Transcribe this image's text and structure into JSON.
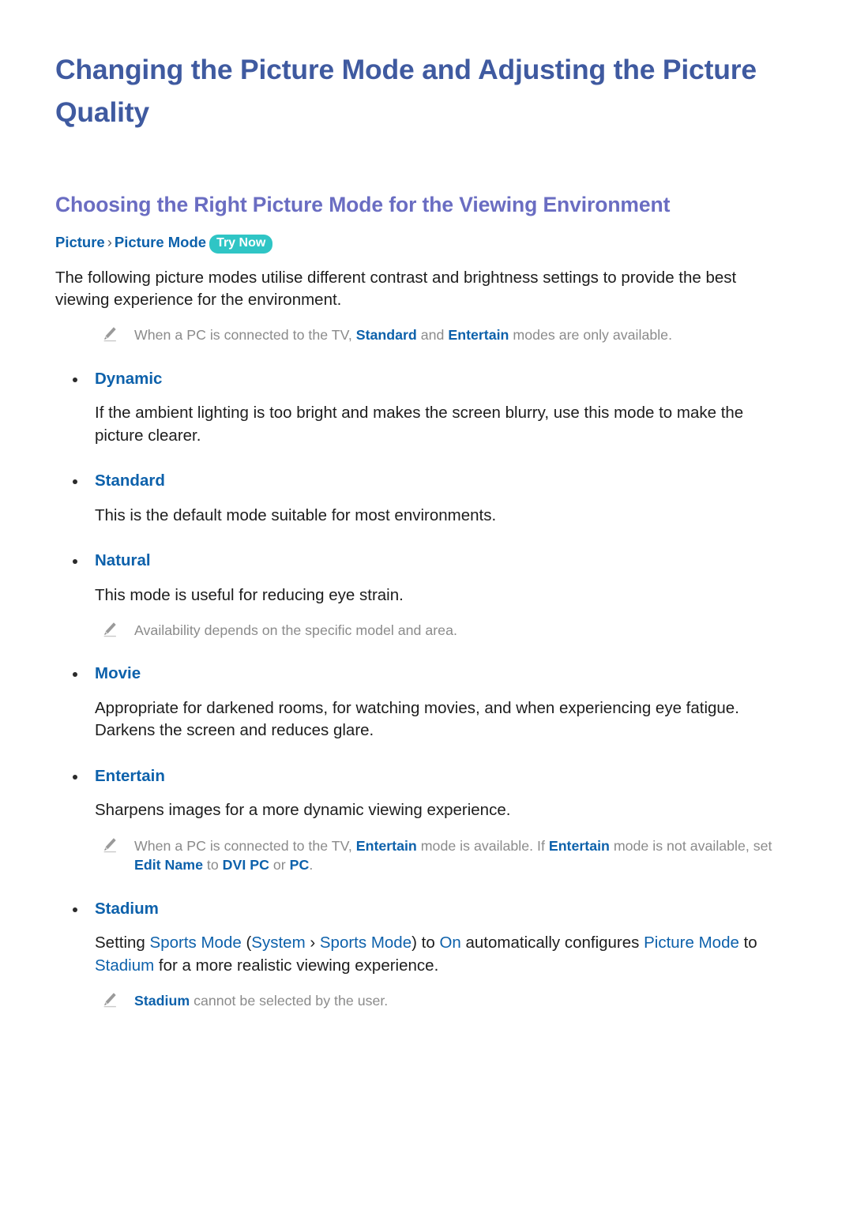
{
  "document": {
    "title": "Changing the Picture Mode and Adjusting the Picture Quality",
    "section_title": "Choosing the Right Picture Mode for the Viewing Environment"
  },
  "breadcrumb": {
    "root": "Picture",
    "separator": "›",
    "leaf": "Picture Mode",
    "badge": "Try Now"
  },
  "intro": {
    "paragraph": "The following picture modes utilise different contrast and brightness settings to provide the best viewing experience for the environment."
  },
  "intro_note": {
    "icon": "pencil-icon",
    "text_1": "When a PC is connected to the TV, ",
    "term_1": "Standard",
    "text_2": " and ",
    "term_2": "Entertain",
    "text_3": " modes are only available."
  },
  "modes": [
    {
      "label": "Dynamic",
      "description": "If the ambient lighting is too bright and makes the screen blurry, use this mode to make the picture clearer."
    },
    {
      "label": "Standard",
      "description": "This is the default mode suitable for most environments."
    },
    {
      "label": "Natural",
      "description": "This mode is useful for reducing eye strain.",
      "note": "Availability depends on the specific model and area."
    },
    {
      "label": "Movie",
      "description": "Appropriate for darkened rooms, for watching movies, and when experiencing eye fatigue. Darkens the screen and reduces glare."
    },
    {
      "label": "Entertain",
      "description": "Sharpens images for a more dynamic viewing experience."
    },
    {
      "label": "Stadium"
    }
  ],
  "entertain_note": {
    "icon": "pencil-icon",
    "t1": "When a PC is connected to the TV, ",
    "k1": "Entertain",
    "t2": " mode is available. If ",
    "k2": "Entertain",
    "t3": " mode is not available, set ",
    "k3": "Edit Name",
    "t4": " to ",
    "k4": "DVI PC",
    "t5": " or ",
    "k5": "PC",
    "t6": "."
  },
  "stadium_body": {
    "t1": "Setting ",
    "k1": "Sports Mode",
    "t2": " (",
    "k2": "System",
    "t3": " › ",
    "k3": "Sports Mode",
    "t4": ") to ",
    "k4": "On",
    "t5": " automatically configures ",
    "k5": "Picture Mode",
    "t6": " to ",
    "k6": "Stadium",
    "t7": " for a more realistic viewing experience."
  },
  "stadium_note": {
    "icon": "pencil-icon",
    "k1": "Stadium",
    "t1": " cannot be selected by the user."
  },
  "colors": {
    "doc_title": "#3f5aa0",
    "section_title": "#6a6dc2",
    "link_blue": "#0d61ab",
    "badge_teal": "#2fc5c5",
    "note_gray": "#8b8b8b",
    "body_text": "#1d1d1d",
    "page_background": "#ffffff"
  }
}
